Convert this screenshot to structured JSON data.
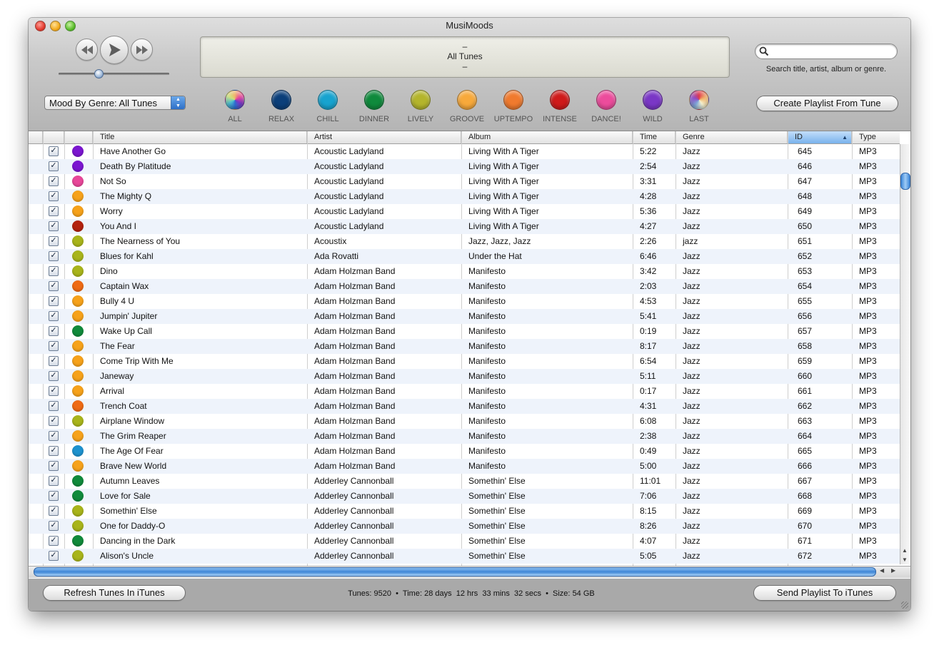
{
  "window": {
    "title": "MusiMoods"
  },
  "lcd": {
    "line1": "–",
    "line2": "All Tunes",
    "line3": "–"
  },
  "search": {
    "placeholder": "",
    "hint": "Search title, artist, album or genre."
  },
  "mood_select": {
    "value": "Mood By Genre: All Tunes"
  },
  "moods": [
    {
      "label": "ALL",
      "color": "multi"
    },
    {
      "label": "RELAX",
      "color": "#0b3f7a"
    },
    {
      "label": "CHILL",
      "color": "#17a3cf"
    },
    {
      "label": "DINNER",
      "color": "#0f8a3c"
    },
    {
      "label": "LIVELY",
      "color": "#b4b52c"
    },
    {
      "label": "GROOVE",
      "color": "#f7a93b"
    },
    {
      "label": "UPTEMPO",
      "color": "#f07a2e"
    },
    {
      "label": "INTENSE",
      "color": "#cf1b1b"
    },
    {
      "label": "DANCE!",
      "color": "#ec4c9c"
    },
    {
      "label": "WILD",
      "color": "#7a37c6"
    },
    {
      "label": "LAST",
      "color": "multi"
    }
  ],
  "buttons": {
    "create_playlist": "Create Playlist From Tune",
    "refresh": "Refresh Tunes In iTunes",
    "send": "Send Playlist To iTunes"
  },
  "columns": [
    "Title",
    "Artist",
    "Album",
    "Time",
    "Genre",
    "ID",
    "Type"
  ],
  "sort": {
    "column": "ID",
    "direction": "ascending"
  },
  "mood_colors": {
    "purple": "#7b16d0",
    "pink": "#e8479a",
    "orange": "#f6a21b",
    "darkred": "#b3220e",
    "olive": "#a8b41b",
    "darkorange": "#ee6a14",
    "green": "#108a3b",
    "blue": "#1d92cf"
  },
  "tracks": [
    {
      "checked": true,
      "mood": "purple",
      "title": "Have Another Go",
      "artist": "Acoustic Ladyland",
      "album": "Living With A Tiger",
      "time": "5:22",
      "genre": "Jazz",
      "id": "645",
      "type": "MP3"
    },
    {
      "checked": true,
      "mood": "purple",
      "title": "Death By Platitude",
      "artist": "Acoustic Ladyland",
      "album": "Living With A Tiger",
      "time": "2:54",
      "genre": "Jazz",
      "id": "646",
      "type": "MP3"
    },
    {
      "checked": true,
      "mood": "pink",
      "title": "Not So",
      "artist": "Acoustic Ladyland",
      "album": "Living With A Tiger",
      "time": "3:31",
      "genre": "Jazz",
      "id": "647",
      "type": "MP3"
    },
    {
      "checked": true,
      "mood": "orange",
      "title": "The Mighty Q",
      "artist": "Acoustic Ladyland",
      "album": "Living With A Tiger",
      "time": "4:28",
      "genre": "Jazz",
      "id": "648",
      "type": "MP3"
    },
    {
      "checked": true,
      "mood": "orange",
      "title": "Worry",
      "artist": "Acoustic Ladyland",
      "album": "Living With A Tiger",
      "time": "5:36",
      "genre": "Jazz",
      "id": "649",
      "type": "MP3"
    },
    {
      "checked": true,
      "mood": "darkred",
      "title": "You And I",
      "artist": "Acoustic Ladyland",
      "album": "Living With A Tiger",
      "time": "4:27",
      "genre": "Jazz",
      "id": "650",
      "type": "MP3"
    },
    {
      "checked": true,
      "mood": "olive",
      "title": "The Nearness of You",
      "artist": "Acoustix",
      "album": "Jazz, Jazz, Jazz",
      "time": "2:26",
      "genre": "jazz",
      "id": "651",
      "type": "MP3"
    },
    {
      "checked": true,
      "mood": "olive",
      "title": "Blues for Kahl",
      "artist": "Ada Rovatti",
      "album": "Under the Hat",
      "time": "6:46",
      "genre": "Jazz",
      "id": "652",
      "type": "MP3"
    },
    {
      "checked": true,
      "mood": "olive",
      "title": "Dino",
      "artist": "Adam Holzman Band",
      "album": "Manifesto",
      "time": "3:42",
      "genre": "Jazz",
      "id": "653",
      "type": "MP3"
    },
    {
      "checked": true,
      "mood": "darkorange",
      "title": "Captain Wax",
      "artist": "Adam Holzman Band",
      "album": "Manifesto",
      "time": "2:03",
      "genre": "Jazz",
      "id": "654",
      "type": "MP3"
    },
    {
      "checked": true,
      "mood": "orange",
      "title": "Bully 4 U",
      "artist": "Adam Holzman Band",
      "album": "Manifesto",
      "time": "4:53",
      "genre": "Jazz",
      "id": "655",
      "type": "MP3"
    },
    {
      "checked": true,
      "mood": "orange",
      "title": "Jumpin' Jupiter",
      "artist": "Adam Holzman Band",
      "album": "Manifesto",
      "time": "5:41",
      "genre": "Jazz",
      "id": "656",
      "type": "MP3"
    },
    {
      "checked": true,
      "mood": "green",
      "title": "Wake Up Call",
      "artist": "Adam Holzman Band",
      "album": "Manifesto",
      "time": "0:19",
      "genre": "Jazz",
      "id": "657",
      "type": "MP3"
    },
    {
      "checked": true,
      "mood": "orange",
      "title": "The Fear",
      "artist": "Adam Holzman Band",
      "album": "Manifesto",
      "time": "8:17",
      "genre": "Jazz",
      "id": "658",
      "type": "MP3"
    },
    {
      "checked": true,
      "mood": "orange",
      "title": "Come Trip With Me",
      "artist": "Adam Holzman Band",
      "album": "Manifesto",
      "time": "6:54",
      "genre": "Jazz",
      "id": "659",
      "type": "MP3"
    },
    {
      "checked": true,
      "mood": "orange",
      "title": "Janeway",
      "artist": "Adam Holzman Band",
      "album": "Manifesto",
      "time": "5:11",
      "genre": "Jazz",
      "id": "660",
      "type": "MP3"
    },
    {
      "checked": true,
      "mood": "orange",
      "title": "Arrival",
      "artist": "Adam Holzman Band",
      "album": "Manifesto",
      "time": "0:17",
      "genre": "Jazz",
      "id": "661",
      "type": "MP3"
    },
    {
      "checked": true,
      "mood": "darkorange",
      "title": "Trench Coat",
      "artist": "Adam Holzman Band",
      "album": "Manifesto",
      "time": "4:31",
      "genre": "Jazz",
      "id": "662",
      "type": "MP3"
    },
    {
      "checked": true,
      "mood": "olive",
      "title": "Airplane Window",
      "artist": "Adam Holzman Band",
      "album": "Manifesto",
      "time": "6:08",
      "genre": "Jazz",
      "id": "663",
      "type": "MP3"
    },
    {
      "checked": true,
      "mood": "orange",
      "title": "The Grim Reaper",
      "artist": "Adam Holzman Band",
      "album": "Manifesto",
      "time": "2:38",
      "genre": "Jazz",
      "id": "664",
      "type": "MP3"
    },
    {
      "checked": true,
      "mood": "blue",
      "title": "The Age Of Fear",
      "artist": "Adam Holzman Band",
      "album": "Manifesto",
      "time": "0:49",
      "genre": "Jazz",
      "id": "665",
      "type": "MP3"
    },
    {
      "checked": true,
      "mood": "orange",
      "title": "Brave New World",
      "artist": "Adam Holzman Band",
      "album": "Manifesto",
      "time": "5:00",
      "genre": "Jazz",
      "id": "666",
      "type": "MP3"
    },
    {
      "checked": true,
      "mood": "green",
      "title": "Autumn Leaves",
      "artist": "Adderley Cannonball",
      "album": "Somethin' Else",
      "time": "11:01",
      "genre": "Jazz",
      "id": "667",
      "type": "MP3"
    },
    {
      "checked": true,
      "mood": "green",
      "title": "Love for Sale",
      "artist": "Adderley Cannonball",
      "album": "Somethin' Else",
      "time": "7:06",
      "genre": "Jazz",
      "id": "668",
      "type": "MP3"
    },
    {
      "checked": true,
      "mood": "olive",
      "title": "Somethin' Else",
      "artist": "Adderley Cannonball",
      "album": "Somethin' Else",
      "time": "8:15",
      "genre": "Jazz",
      "id": "669",
      "type": "MP3"
    },
    {
      "checked": true,
      "mood": "olive",
      "title": "One for Daddy-O",
      "artist": "Adderley Cannonball",
      "album": "Somethin' Else",
      "time": "8:26",
      "genre": "Jazz",
      "id": "670",
      "type": "MP3"
    },
    {
      "checked": true,
      "mood": "green",
      "title": "Dancing in the Dark",
      "artist": "Adderley Cannonball",
      "album": "Somethin' Else",
      "time": "4:07",
      "genre": "Jazz",
      "id": "671",
      "type": "MP3"
    },
    {
      "checked": true,
      "mood": "olive",
      "title": "Alison's Uncle",
      "artist": "Adderley Cannonball",
      "album": "Somethin' Else",
      "time": "5:05",
      "genre": "Jazz",
      "id": "672",
      "type": "MP3"
    }
  ],
  "status": {
    "tunes_label": "Tunes:",
    "tunes": "9520",
    "time_label": "Time:",
    "time": "28 days  12 hrs  33 mins  32 secs",
    "size_label": "Size:",
    "size": "54 GB"
  }
}
